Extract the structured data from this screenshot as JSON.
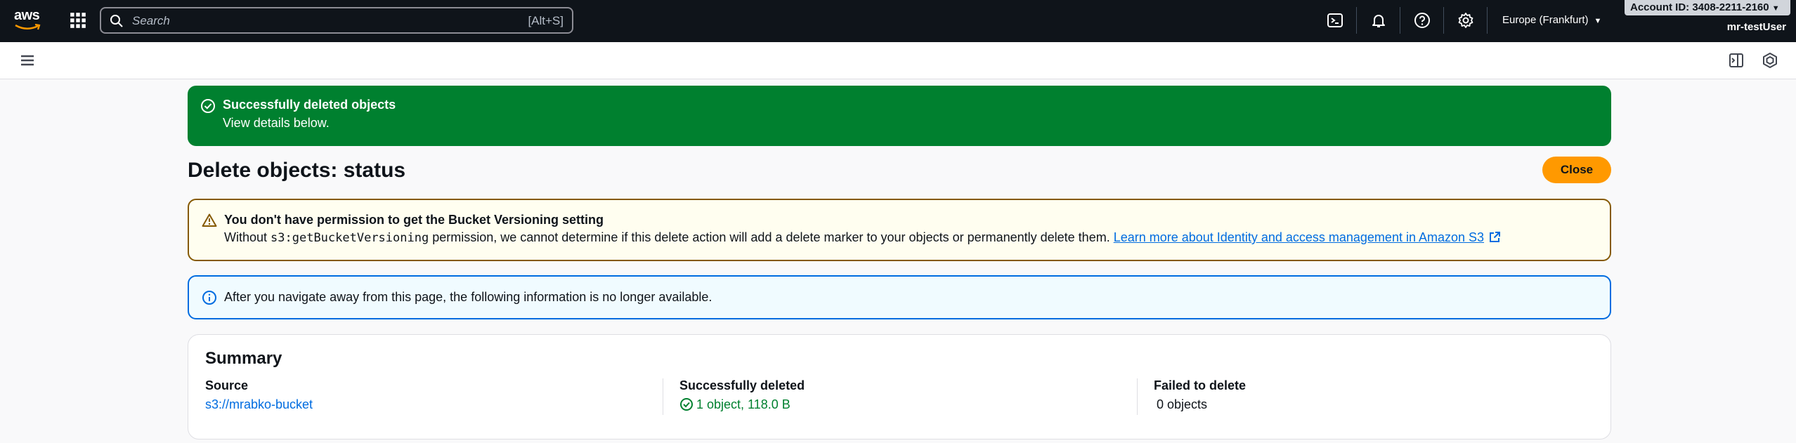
{
  "topnav": {
    "logo_text": "aws",
    "search": {
      "placeholder": "Search",
      "shortcut": "[Alt+S]"
    },
    "region": "Europe (Frankfurt)",
    "account_id": "Account ID: 3408-2211-2160",
    "user": "mr-testUser"
  },
  "flash": {
    "title": "Successfully deleted objects",
    "body": "View details below."
  },
  "page": {
    "title": "Delete objects: status",
    "close_label": "Close"
  },
  "warning": {
    "title": "You don't have permission to get the Bucket Versioning setting",
    "body_prefix": "Without ",
    "code": "s3:getBucketVersioning",
    "body_suffix": " permission, we cannot determine if this delete action will add a delete marker to your objects or permanently delete them. ",
    "link": "Learn more about Identity and access management in Amazon S3"
  },
  "info": {
    "text": "After you navigate away from this page, the following information is no longer available."
  },
  "summary": {
    "title": "Summary",
    "source_label": "Source",
    "source_value": "s3://mrabko-bucket",
    "deleted_label": "Successfully deleted",
    "deleted_value": "1 object, 118.0 B",
    "failed_label": "Failed to delete",
    "failed_value": "0 objects"
  },
  "colors": {
    "nav_bg": "#0f141a",
    "success": "#00802f",
    "warning_border": "#855900",
    "info_border": "#006ce0",
    "primary_button": "#ff9900",
    "link": "#006ce0"
  }
}
